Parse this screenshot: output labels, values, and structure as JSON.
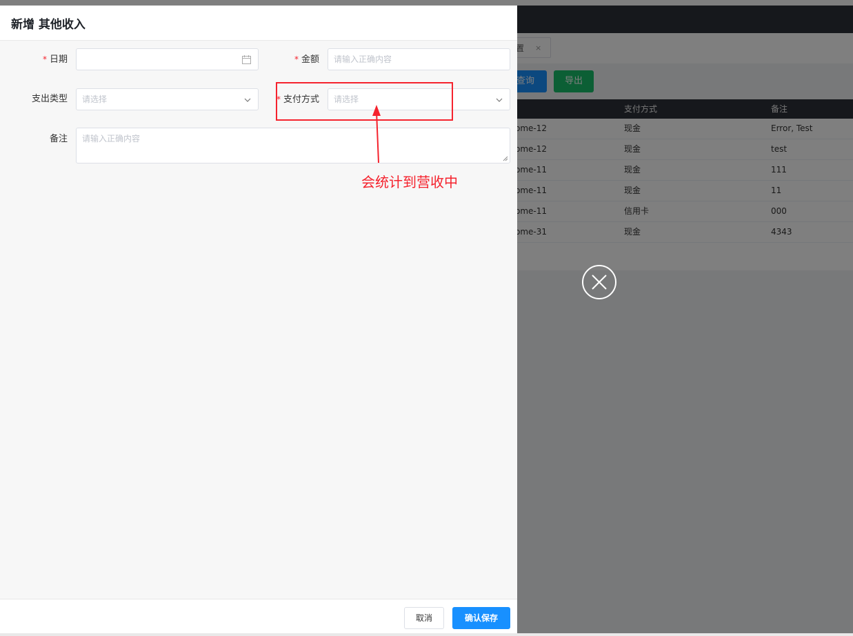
{
  "background": {
    "tab_label": "置",
    "tab_close": "×",
    "query_button": "查询",
    "export_button": "导出",
    "table": {
      "headers": [
        "支付方式",
        "备注"
      ],
      "rows": [
        {
          "name": "ome-12",
          "payment": "现金",
          "remark": "Error, Test"
        },
        {
          "name": "ome-12",
          "payment": "现金",
          "remark": "test"
        },
        {
          "name": "ome-11",
          "payment": "现金",
          "remark": "111"
        },
        {
          "name": "ome-11",
          "payment": "现金",
          "remark": "11"
        },
        {
          "name": "ome-11",
          "payment": "信用卡",
          "remark": "000"
        },
        {
          "name": "ome-31",
          "payment": "现金",
          "remark": "4343"
        }
      ]
    }
  },
  "drawer": {
    "title": "新增 其他收入",
    "form": {
      "date_label": "日期",
      "date_value": "",
      "amount_label": "金额",
      "amount_placeholder": "请输入正确内容",
      "expense_type_label": "支出类型",
      "expense_type_placeholder": "请选择",
      "payment_method_label": "支付方式",
      "payment_method_placeholder": "请选择",
      "remark_label": "备注",
      "remark_placeholder": "请输入正确内容",
      "required_mark": "*"
    },
    "footer": {
      "cancel_label": "取消",
      "save_label": "确认保存"
    }
  },
  "annotation": {
    "text": "会统计到营收中",
    "color": "#f5222d"
  },
  "colors": {
    "primary": "#1890ff",
    "success": "#19be6b",
    "header_dark": "#2c3038"
  }
}
